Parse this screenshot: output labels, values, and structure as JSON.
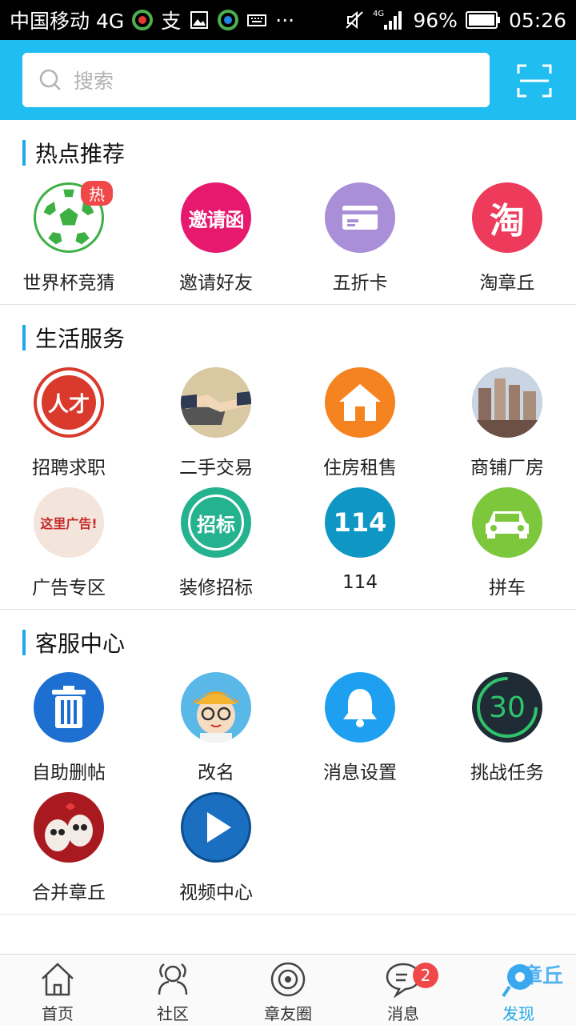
{
  "status_bar": {
    "carrier": "中国移动 4G",
    "battery": "96%",
    "time": "05:26"
  },
  "search": {
    "placeholder": "搜索"
  },
  "sections": [
    {
      "title": "热点推荐",
      "items": [
        {
          "label": "世界杯竞猜",
          "icon": "soccer-ball-icon",
          "badge": "热"
        },
        {
          "label": "邀请好友",
          "icon": "invite-letter-icon",
          "text": "邀请函"
        },
        {
          "label": "五折卡",
          "icon": "card-icon"
        },
        {
          "label": "淘章丘",
          "icon": "taobao-icon",
          "text": "淘"
        }
      ]
    },
    {
      "title": "生活服务",
      "items": [
        {
          "label": "招聘求职",
          "icon": "recruit-icon",
          "text": "人才"
        },
        {
          "label": "二手交易",
          "icon": "handshake-icon"
        },
        {
          "label": "住房租售",
          "icon": "house-icon"
        },
        {
          "label": "商铺厂房",
          "icon": "buildings-icon"
        },
        {
          "label": "广告专区",
          "icon": "ad-zone-icon",
          "text": "这里广告!"
        },
        {
          "label": "装修招标",
          "icon": "bidding-icon",
          "text": "招标"
        },
        {
          "label": "114",
          "icon": "phone-114-icon",
          "text": "114"
        },
        {
          "label": "拼车",
          "icon": "car-icon"
        }
      ]
    },
    {
      "title": "客服中心",
      "items": [
        {
          "label": "自助删帖",
          "icon": "trash-icon"
        },
        {
          "label": "改名",
          "icon": "avatar-rename-icon"
        },
        {
          "label": "消息设置",
          "icon": "bell-icon"
        },
        {
          "label": "挑战任务",
          "icon": "challenge-timer-icon",
          "text": "30"
        },
        {
          "label": "合并章丘",
          "icon": "merge-eggs-icon"
        },
        {
          "label": "视频中心",
          "icon": "play-icon"
        }
      ]
    }
  ],
  "tabbar": [
    {
      "label": "首页",
      "icon": "home-icon"
    },
    {
      "label": "社区",
      "icon": "community-icon"
    },
    {
      "label": "章友圈",
      "icon": "circle-icon"
    },
    {
      "label": "消息",
      "icon": "message-icon",
      "badge": "2"
    },
    {
      "label": "发现",
      "icon": "discover-icon",
      "watermark": "章丘",
      "active": true
    }
  ],
  "colors": {
    "topbar": "#1fbdf0",
    "accent": "#1fa8e8",
    "badge": "#f04848"
  }
}
